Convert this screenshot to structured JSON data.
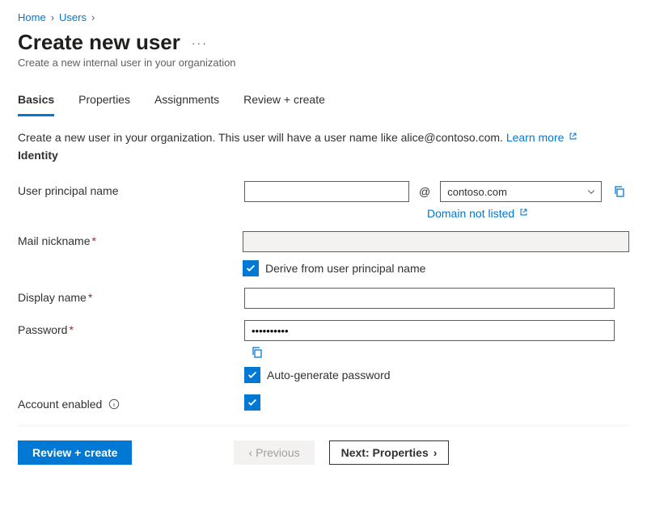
{
  "breadcrumb": {
    "home": "Home",
    "users": "Users"
  },
  "title": "Create new user",
  "subtitle": "Create a new internal user in your organization",
  "tabs": {
    "basics": "Basics",
    "properties": "Properties",
    "assignments": "Assignments",
    "review": "Review + create"
  },
  "description": "Create a new user in your organization. This user will have a user name like alice@contoso.com.",
  "learn_more": "Learn more",
  "section_identity": "Identity",
  "fields": {
    "upn_label": "User principal name",
    "upn_value": "",
    "domain": "contoso.com",
    "domain_not_listed": "Domain not listed",
    "mail_nickname_label": "Mail nickname",
    "mail_nickname_value": "",
    "derive_label": "Derive from user principal name",
    "display_name_label": "Display name",
    "display_name_value": "",
    "password_label": "Password",
    "password_value": "••••••••••",
    "autogen_label": "Auto-generate password",
    "account_enabled_label": "Account enabled"
  },
  "footer": {
    "review": "Review + create",
    "previous": "Previous",
    "next": "Next: Properties"
  }
}
